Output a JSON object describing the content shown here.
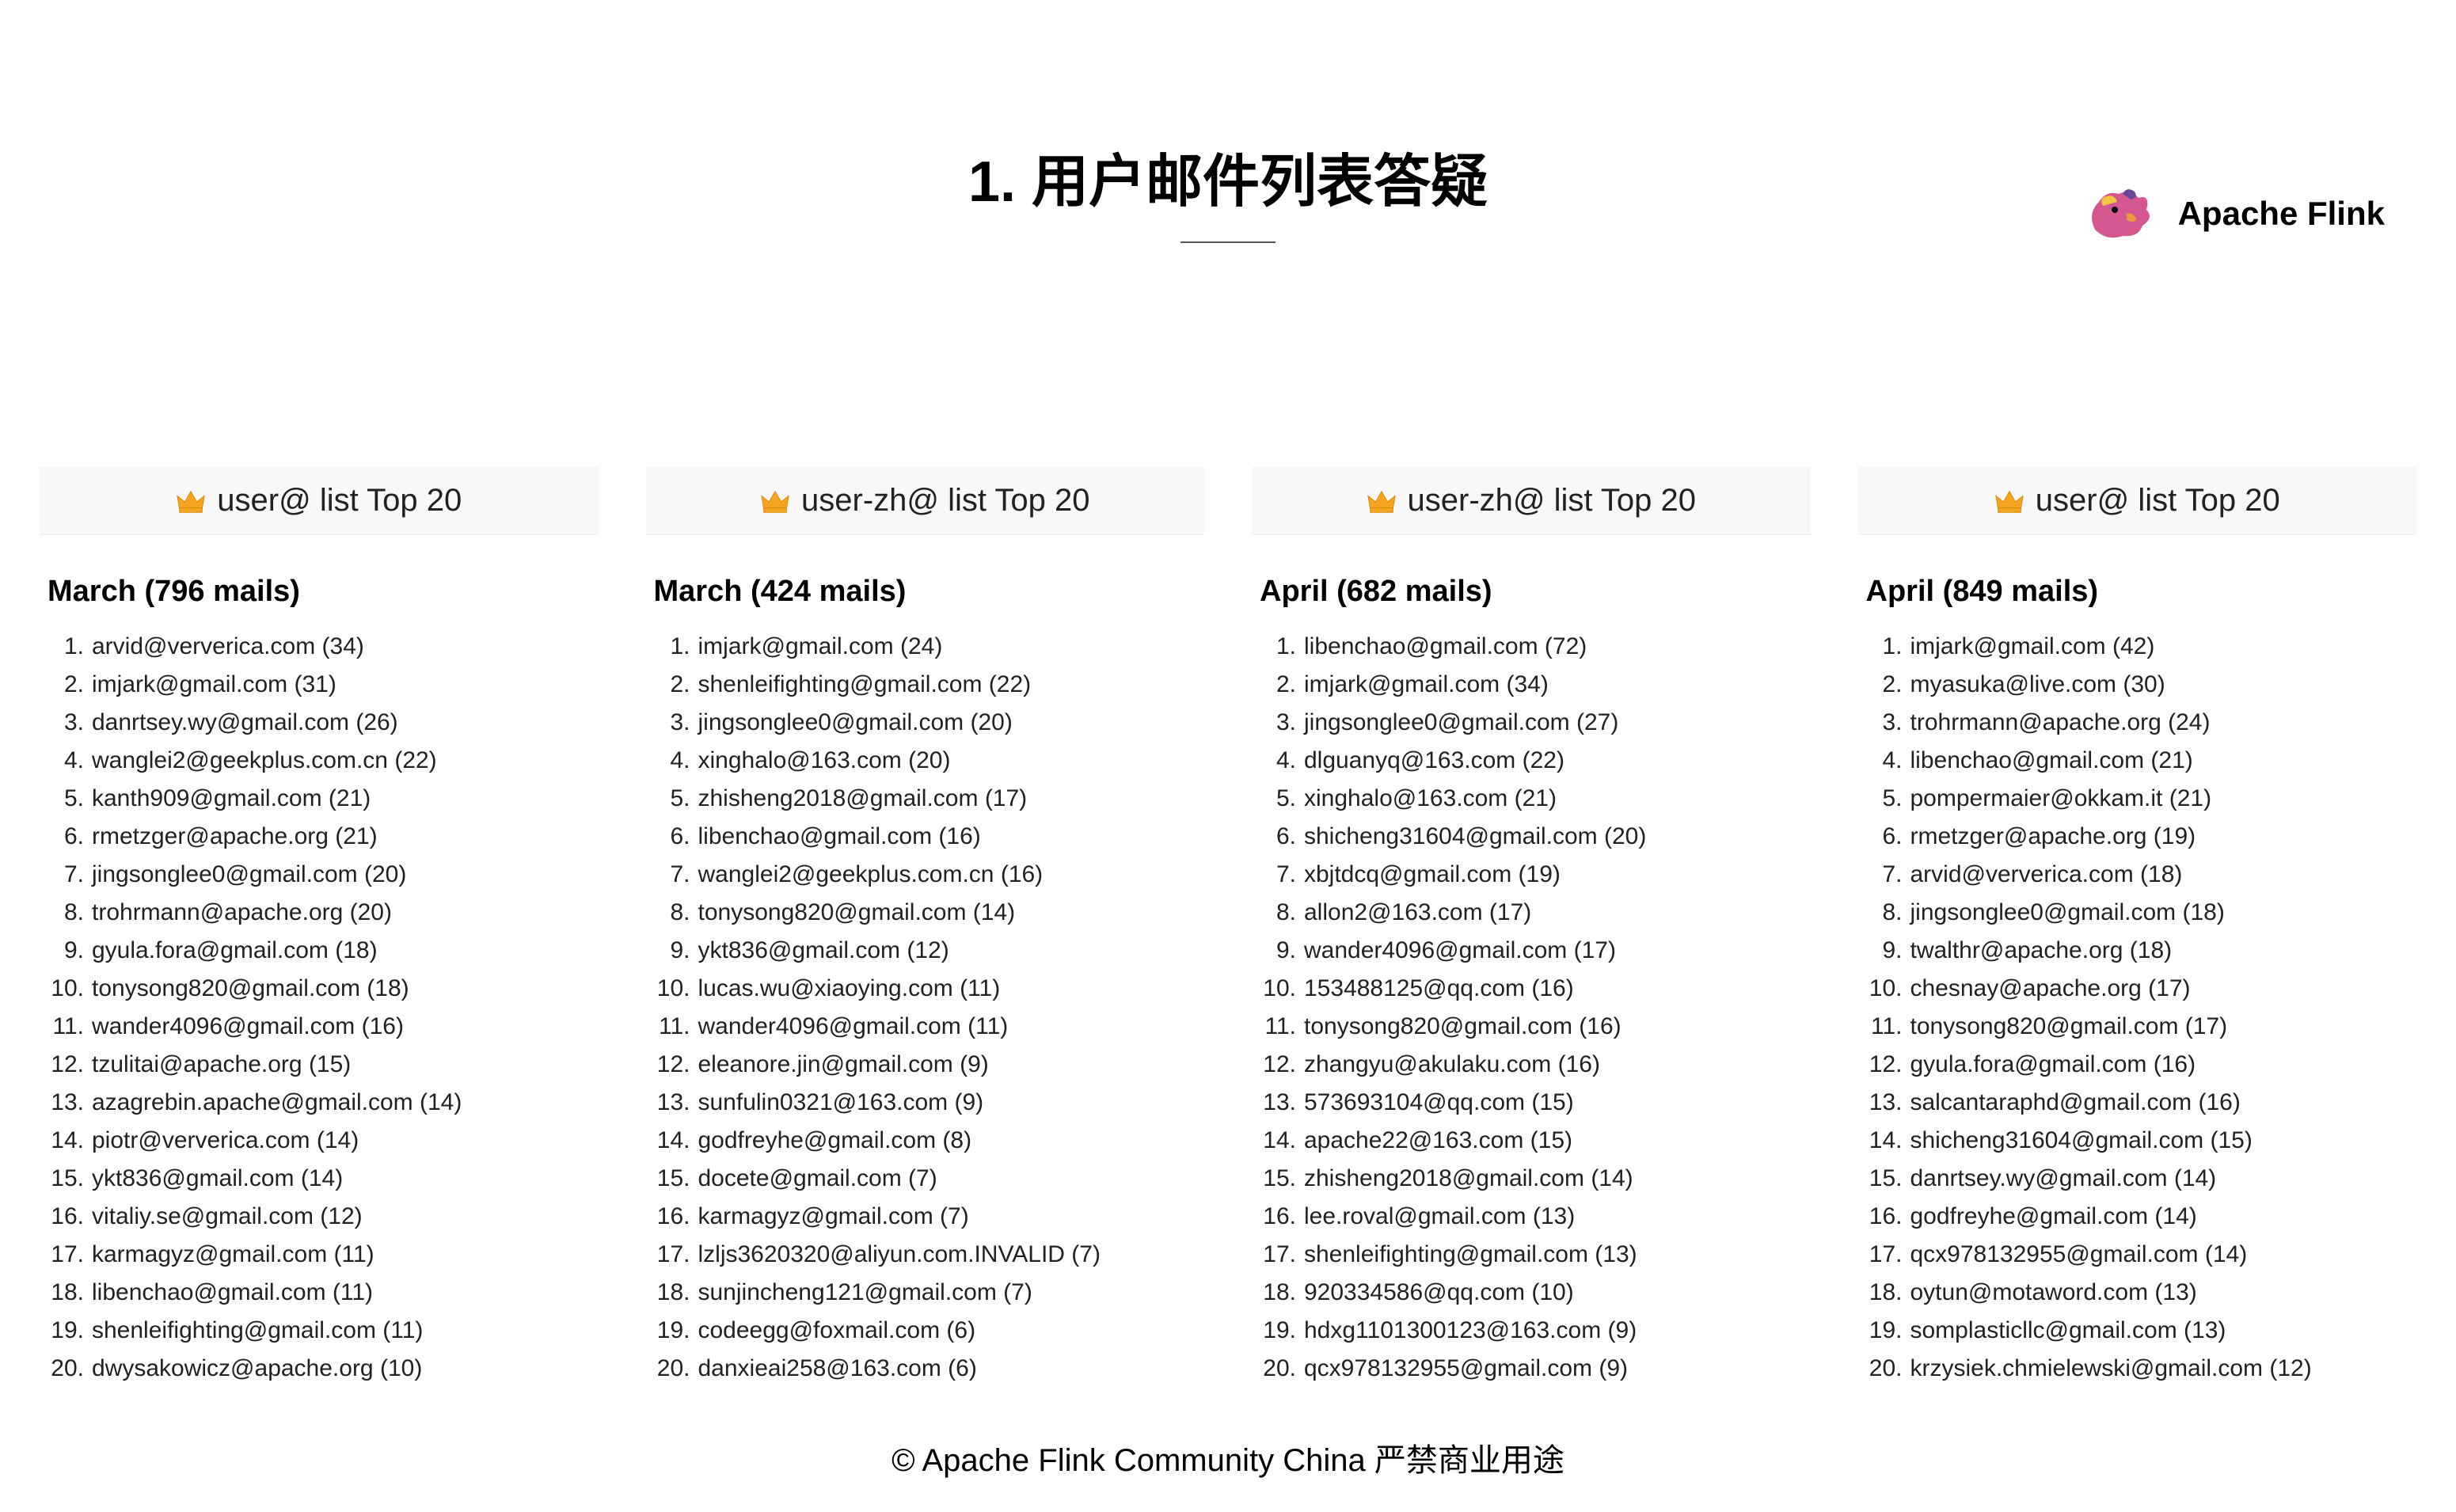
{
  "logo": {
    "text": "Apache Flink"
  },
  "title": "1. 用户邮件列表答疑",
  "columns": [
    {
      "header": "user@ list Top 20",
      "month": "March (796 mails)",
      "items": [
        "arvid@ververica.com (34)",
        "imjark@gmail.com (31)",
        "danrtsey.wy@gmail.com (26)",
        "wanglei2@geekplus.com.cn (22)",
        "kanth909@gmail.com (21)",
        "rmetzger@apache.org (21)",
        "jingsonglee0@gmail.com (20)",
        "trohrmann@apache.org (20)",
        "gyula.fora@gmail.com (18)",
        "tonysong820@gmail.com (18)",
        "wander4096@gmail.com (16)",
        "tzulitai@apache.org (15)",
        "azagrebin.apache@gmail.com (14)",
        "piotr@ververica.com (14)",
        "ykt836@gmail.com (14)",
        "vitaliy.se@gmail.com (12)",
        "karmagyz@gmail.com (11)",
        "libenchao@gmail.com (11)",
        "shenleifighting@gmail.com (11)",
        "dwysakowicz@apache.org (10)"
      ]
    },
    {
      "header": "user-zh@ list Top 20",
      "month": "March (424 mails)",
      "items": [
        "imjark@gmail.com (24)",
        "shenleifighting@gmail.com (22)",
        "jingsonglee0@gmail.com (20)",
        "xinghalo@163.com (20)",
        "zhisheng2018@gmail.com (17)",
        "libenchao@gmail.com (16)",
        "wanglei2@geekplus.com.cn (16)",
        "tonysong820@gmail.com (14)",
        "ykt836@gmail.com (12)",
        "lucas.wu@xiaoying.com (11)",
        "wander4096@gmail.com (11)",
        "eleanore.jin@gmail.com (9)",
        "sunfulin0321@163.com (9)",
        "godfreyhe@gmail.com (8)",
        "docete@gmail.com (7)",
        "karmagyz@gmail.com (7)",
        "lzljs3620320@aliyun.com.INVALID (7)",
        "sunjincheng121@gmail.com (7)",
        "codeegg@foxmail.com (6)",
        "danxieai258@163.com (6)"
      ]
    },
    {
      "header": "user-zh@ list Top 20",
      "month": "April (682 mails)",
      "items": [
        "libenchao@gmail.com (72)",
        "imjark@gmail.com (34)",
        "jingsonglee0@gmail.com (27)",
        "dlguanyq@163.com (22)",
        "xinghalo@163.com (21)",
        "shicheng31604@gmail.com (20)",
        "xbjtdcq@gmail.com (19)",
        "allon2@163.com (17)",
        "wander4096@gmail.com (17)",
        "153488125@qq.com (16)",
        "tonysong820@gmail.com (16)",
        "zhangyu@akulaku.com (16)",
        "573693104@qq.com (15)",
        "apache22@163.com (15)",
        "zhisheng2018@gmail.com (14)",
        "lee.roval@gmail.com (13)",
        "shenleifighting@gmail.com (13)",
        "920334586@qq.com (10)",
        "hdxg1101300123@163.com (9)",
        "qcx978132955@gmail.com (9)"
      ]
    },
    {
      "header": "user@ list Top 20",
      "month": "April (849 mails)",
      "items": [
        "imjark@gmail.com (42)",
        "myasuka@live.com (30)",
        "trohrmann@apache.org (24)",
        "libenchao@gmail.com (21)",
        "pompermaier@okkam.it (21)",
        "rmetzger@apache.org (19)",
        "arvid@ververica.com (18)",
        "jingsonglee0@gmail.com (18)",
        "twalthr@apache.org (18)",
        "chesnay@apache.org (17)",
        "tonysong820@gmail.com (17)",
        "gyula.fora@gmail.com (16)",
        "salcantaraphd@gmail.com (16)",
        "shicheng31604@gmail.com (15)",
        "danrtsey.wy@gmail.com (14)",
        "godfreyhe@gmail.com (14)",
        "qcx978132955@gmail.com (14)",
        "oytun@motaword.com (13)",
        "somplasticllc@gmail.com (13)",
        "krzysiek.chmielewski@gmail.com (12)"
      ]
    }
  ],
  "footer": "© Apache Flink Community China  严禁商业用途"
}
